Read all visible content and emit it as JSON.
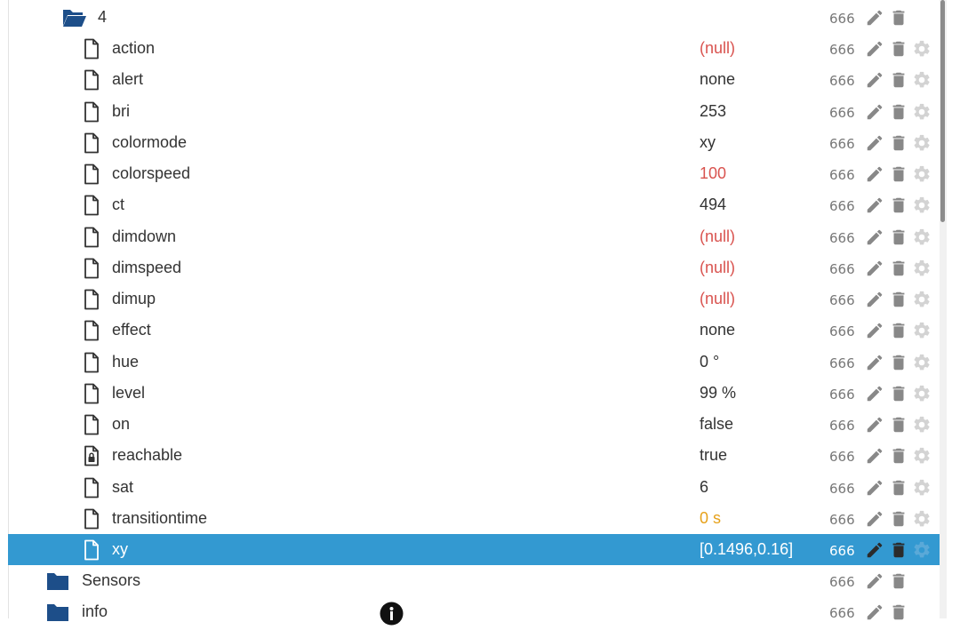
{
  "tree": {
    "folder_4": {
      "label": "4",
      "acl": "666"
    },
    "states": [
      {
        "name": "action",
        "value": "(null)",
        "value_style": "null",
        "acl": "666",
        "icon": "file-icon"
      },
      {
        "name": "alert",
        "value": "none",
        "value_style": "normal",
        "acl": "666",
        "icon": "file-icon"
      },
      {
        "name": "bri",
        "value": "253",
        "value_style": "normal",
        "acl": "666",
        "icon": "file-icon"
      },
      {
        "name": "colormode",
        "value": "xy",
        "value_style": "normal",
        "acl": "666",
        "icon": "file-icon"
      },
      {
        "name": "colorspeed",
        "value": "100",
        "value_style": "red",
        "acl": "666",
        "icon": "file-icon"
      },
      {
        "name": "ct",
        "value": "494",
        "value_style": "normal",
        "acl": "666",
        "icon": "file-icon"
      },
      {
        "name": "dimdown",
        "value": "(null)",
        "value_style": "null",
        "acl": "666",
        "icon": "file-icon"
      },
      {
        "name": "dimspeed",
        "value": "(null)",
        "value_style": "null",
        "acl": "666",
        "icon": "file-icon"
      },
      {
        "name": "dimup",
        "value": "(null)",
        "value_style": "null",
        "acl": "666",
        "icon": "file-icon"
      },
      {
        "name": "effect",
        "value": "none",
        "value_style": "normal",
        "acl": "666",
        "icon": "file-icon"
      },
      {
        "name": "hue",
        "value": "0 °",
        "value_style": "normal",
        "acl": "666",
        "icon": "file-icon"
      },
      {
        "name": "level",
        "value": "99 %",
        "value_style": "normal",
        "acl": "666",
        "icon": "file-icon"
      },
      {
        "name": "on",
        "value": "false",
        "value_style": "normal",
        "acl": "666",
        "icon": "file-icon"
      },
      {
        "name": "reachable",
        "value": "true",
        "value_style": "normal",
        "acl": "666",
        "icon": "locked-file-icon"
      },
      {
        "name": "sat",
        "value": "6",
        "value_style": "normal",
        "acl": "666",
        "icon": "file-icon"
      },
      {
        "name": "transitiontime",
        "value": "0 s",
        "value_style": "orange",
        "acl": "666",
        "icon": "file-icon"
      },
      {
        "name": "xy",
        "value": "[0.1496,0.16]",
        "value_style": "normal",
        "acl": "666",
        "icon": "file-icon",
        "selected": true
      }
    ],
    "folder_sensors": {
      "label": "Sensors",
      "acl": "666"
    },
    "folder_info": {
      "label": "info",
      "acl": "666"
    }
  },
  "colors": {
    "selected_row": "#3399d1",
    "folder_icon": "#1d4e89",
    "null_value": "#d9534f",
    "orange_value": "#e6a11a",
    "action_icon": "#888888"
  }
}
